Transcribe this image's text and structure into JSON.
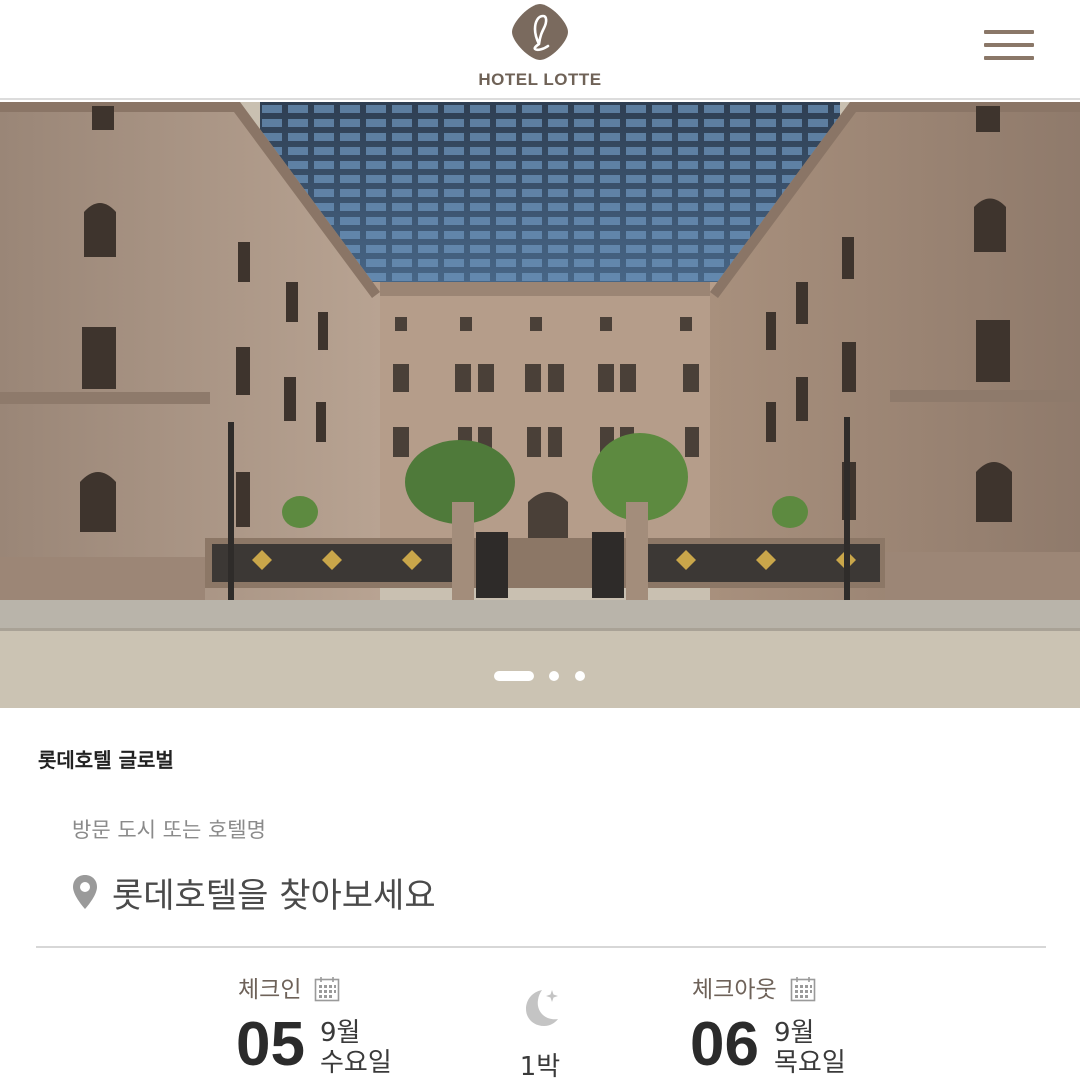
{
  "header": {
    "logo_text": "HOTEL LOTTE",
    "logo_icon": "lotte-l-emblem",
    "menu_icon": "hamburger-menu-icon",
    "brand_color": "#8a7768"
  },
  "hero": {
    "image": "hotel-courtyard-photo",
    "slide_count": 3,
    "active_slide": 1
  },
  "brand_label": "롯데호텔 글로벌",
  "search": {
    "label": "방문 도시 또는 호텔명",
    "value": "롯데호텔을 찾아보세요",
    "icon": "location-pin-icon"
  },
  "checkin": {
    "label": "체크인",
    "day": "05",
    "month": "9월",
    "weekday": "수요일",
    "icon": "calendar-icon"
  },
  "nights": {
    "text": "1박",
    "icon": "moon-icon"
  },
  "checkout": {
    "label": "체크아웃",
    "day": "06",
    "month": "9월",
    "weekday": "목요일",
    "icon": "calendar-icon"
  }
}
